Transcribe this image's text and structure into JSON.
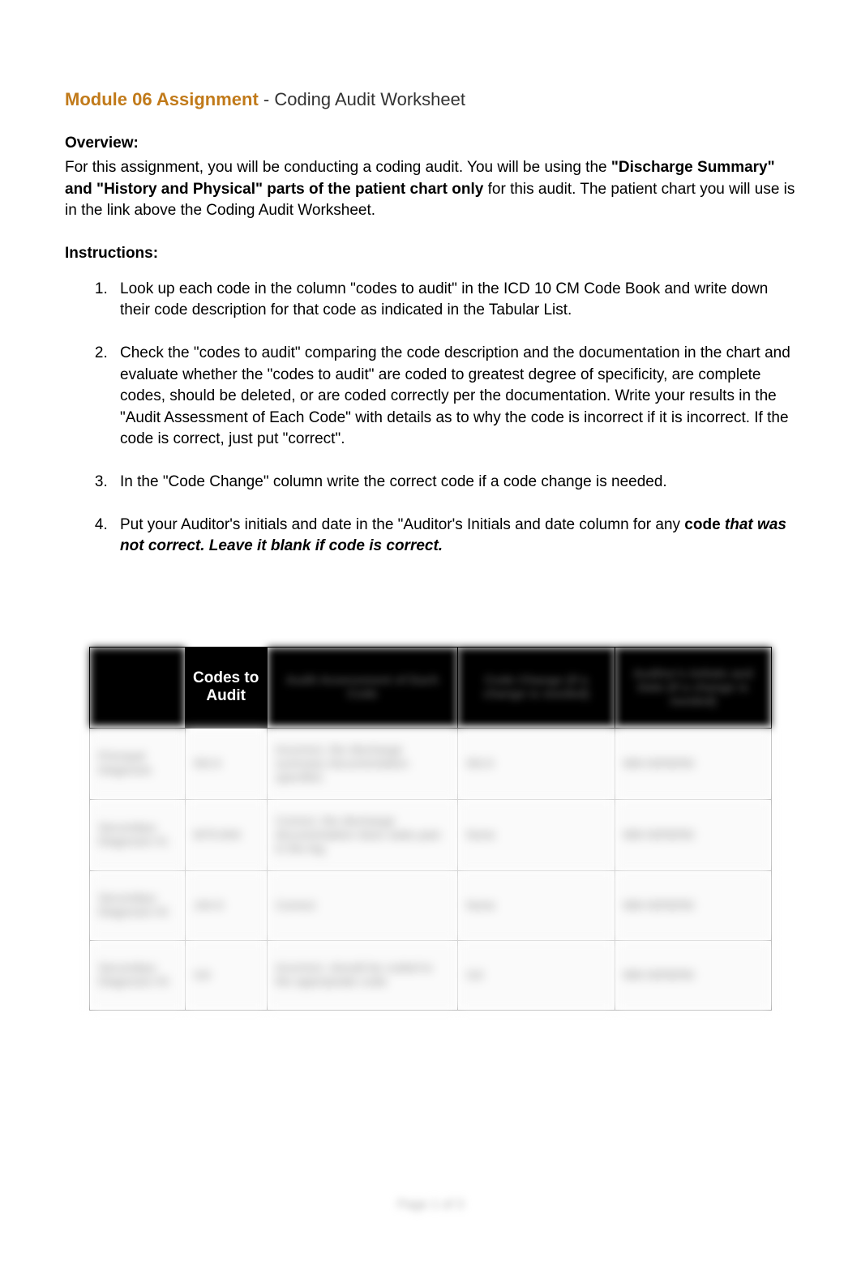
{
  "title": {
    "module": "Module 06 Assignment",
    "dash": " - ",
    "subtitle": "Coding Audit Worksheet"
  },
  "overview": {
    "heading": "Overview:",
    "line1_a": "For this assignment, you will be conducting a coding audit. You will be using the ",
    "line1_b": "\"Discharge Summary\" and \"History and Physical\" parts of the patient chart only",
    "line1_c": " for this audit.  The patient chart you will use is in the link above the Coding Audit Worksheet."
  },
  "instructions": {
    "heading": "Instructions:",
    "items": [
      "Look up each code in the column \"codes to audit\" in the ICD 10 CM Code Book and write down their code description for that code as indicated in the Tabular List.",
      "Check the \"codes to audit\" comparing the code description and the documentation in the chart and evaluate whether the \"codes to audit\" are coded to greatest degree of specificity, are complete codes, should be deleted, or are coded correctly per the documentation.  Write your results in the \"Audit Assessment of Each Code\" with details as to why the code is incorrect if it is incorrect.  If the code is correct, just put \"correct\".",
      "In the \"Code Change\" column write the correct code if a code change is needed."
    ],
    "item4_a": "Put your Auditor's initials and date in the \"Auditor's Initials and date column for any ",
    "item4_b": "code",
    "item4_c": " that was not correct.  Leave it blank if code is correct."
  },
  "table": {
    "headers": {
      "c1": "",
      "c2": "Codes to Audit",
      "c3": "Audit Assessment of Each Code",
      "c4": "Code Change (if a change is needed)",
      "c5": "Auditor's Initials and Date (if a change is needed)"
    },
    "rows": [
      {
        "c1": "Principal Diagnosis",
        "c2": "I50.9",
        "c3": "Incorrect, the discharge summary documentation specifies",
        "c4": "I50.9",
        "c5": "MM 00/00/00"
      },
      {
        "c1": "Secondary Diagnosis #1",
        "c2": "M79.604",
        "c3": "Correct, the discharge documentation does state pain in the leg",
        "c4": "None",
        "c5": "MM 00/00/00"
      },
      {
        "c1": "Secondary Diagnosis #2",
        "c2": "J44.9",
        "c3": "Correct",
        "c4": "None",
        "c5": "MM 00/00/00"
      },
      {
        "c1": "Secondary Diagnosis #3",
        "c2": "I10",
        "c3": "Incorrect, should be coded to the appropriate code",
        "c4": "I10",
        "c5": "MM 00/00/00"
      }
    ]
  },
  "footer": "Page 1 of 3"
}
